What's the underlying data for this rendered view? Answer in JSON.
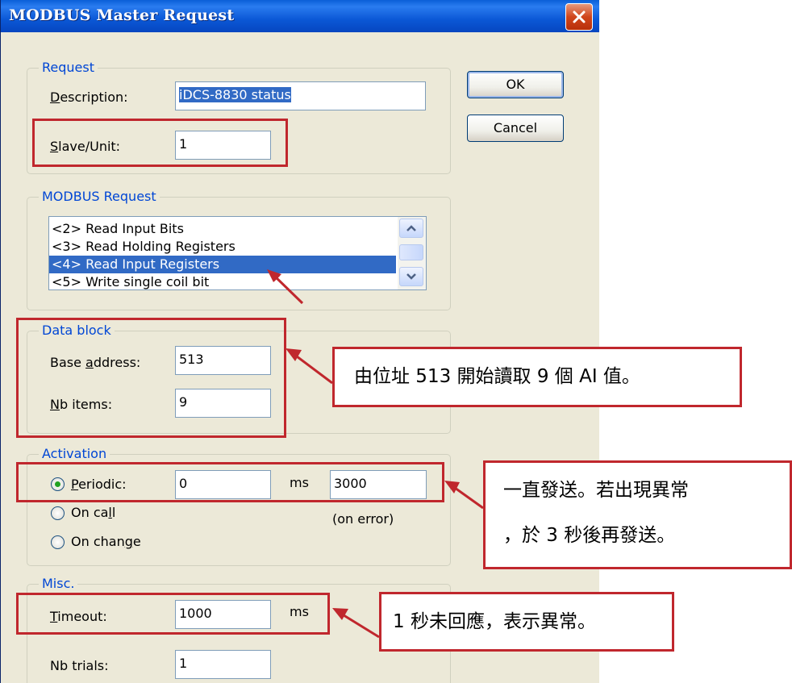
{
  "window": {
    "title": "MODBUS Master Request",
    "close_icon": "close-x-icon"
  },
  "buttons": {
    "ok": "OK",
    "cancel": "Cancel"
  },
  "request_group": {
    "legend": "Request",
    "description_label_u": "D",
    "description_label_rest": "escription:",
    "description_value": "iDCS-8830 status",
    "slave_label_u": "S",
    "slave_label_rest": "lave/Unit:",
    "slave_value": "1"
  },
  "modbus_group": {
    "legend": "MODBUS Request",
    "items": [
      "<2> Read Input Bits",
      "<3> Read Holding Registers",
      "<4> Read Input Registers",
      "<5> Write single coil bit"
    ],
    "selected_index": 2
  },
  "datablock_group": {
    "legend": "Data block",
    "base_label_pre": "Base ",
    "base_label_u": "a",
    "base_label_rest": "ddress:",
    "base_value": "513",
    "nb_label_u": "N",
    "nb_label_rest": "b items:",
    "nb_value": "9"
  },
  "activation_group": {
    "legend": "Activation",
    "periodic_label_u": "P",
    "periodic_label_rest": "eriodic:",
    "periodic_value": "0",
    "periodic_unit": "ms",
    "error_value": "3000",
    "error_note": "(on error)",
    "oncall_label_pre": "On ca",
    "oncall_label_u": "l",
    "oncall_label_rest": "l",
    "onchange_label_pre": "On chan",
    "onchange_label_u": "g",
    "onchange_label_rest": "e",
    "selected": "periodic"
  },
  "misc_group": {
    "legend": "Misc.",
    "timeout_label_u": "T",
    "timeout_label_rest": "imeout:",
    "timeout_value": "1000",
    "timeout_unit": "ms",
    "trials_label": "Nb trials:",
    "trials_value": "1"
  },
  "annotations": {
    "datablock_note": "由位址 513 開始讀取 9 個 AI 值。",
    "activation_note_line1": "一直發送。若出現異常",
    "activation_note_line2": "，於 3 秒後再發送。",
    "timeout_note": "1 秒未回應，表示異常。"
  },
  "colors": {
    "title_bar": "#0b58d6",
    "dialog_bg": "#ece9d8",
    "legend_text": "#0046d5",
    "selection": "#316ac5",
    "annotation_red": "#c0272d"
  }
}
